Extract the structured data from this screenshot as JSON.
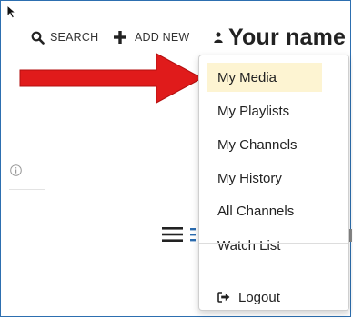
{
  "topbar": {
    "search_label": "SEARCH",
    "add_new_label": "ADD NEW",
    "user_label": "Your name"
  },
  "user_menu": {
    "items": [
      {
        "label": "My Media",
        "active": true
      },
      {
        "label": "My Playlists",
        "active": false
      },
      {
        "label": "My Channels",
        "active": false
      },
      {
        "label": "My History",
        "active": false
      },
      {
        "label": "All Channels",
        "active": false
      },
      {
        "label": "Watch List",
        "active": false
      }
    ],
    "logout_label": "Logout"
  },
  "icons": {
    "search": "search-icon",
    "add_new": "plus-icon",
    "user": "user-icon",
    "logout": "logout-icon",
    "info": "info-icon",
    "menu": "hamburger-icon"
  },
  "colors": {
    "arrow": "#e01b1b",
    "active_item_bg": "#fdf4d2",
    "frame_border": "#2d6fb0"
  }
}
